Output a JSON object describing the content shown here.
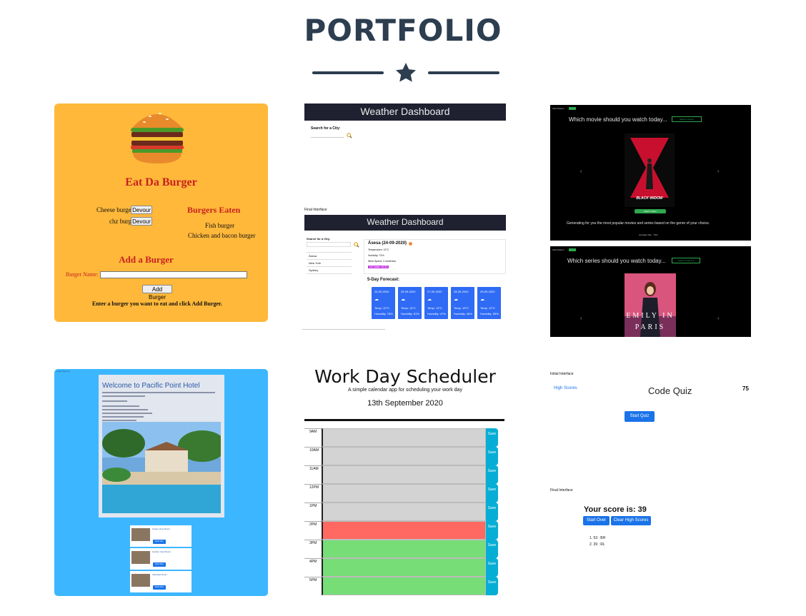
{
  "header": {
    "title": "PORTFOLIO"
  },
  "colors": {
    "heading": "#2c3e50",
    "burger_bg": "#ffb83a",
    "hotel_bg": "#3cb7ff"
  },
  "burger": {
    "title": "Eat Da Burger",
    "items": [
      {
        "name": "Cheese burger",
        "btn": "Devour"
      },
      {
        "name": "chz burg",
        "btn": "Devour"
      }
    ],
    "eaten_title": "Burgers Eaten",
    "eaten": [
      "Fish burger",
      "Chicken and bacon burger"
    ],
    "add_title": "Add a Burger",
    "name_label": "Burger Name:",
    "add_btn": "Add Burger",
    "hint": "Enter a burger you want to eat and click Add Burger."
  },
  "weather": {
    "title": "Weather Dashboard",
    "search_label": "Search for a City:",
    "final_label": "Final Interface",
    "city_title": "Ásesa (24-09-2020)",
    "stats": [
      "Temperature: 19°C",
      "Humidity: 74%",
      "Wind Speed: 3 metre/sec",
      "UV Index: 10.31"
    ],
    "cities": [
      "Ásesa",
      "New York",
      "Sydney"
    ],
    "forecast_title": "5-Day Forecast:",
    "forecast": [
      {
        "date": "25-09-2020",
        "temp": "Temp: 12°C",
        "hum": "Humidity: 78%"
      },
      {
        "date": "26-09-2020",
        "temp": "Temp: 14°C",
        "hum": "Humidity: 61%"
      },
      {
        "date": "27-09-2020",
        "temp": "Temp: 13°C",
        "hum": "Humidity: 47%"
      },
      {
        "date": "28-09-2020",
        "temp": "Temp: 15°C",
        "hum": "Humidity: 46%"
      },
      {
        "date": "29-09-2020",
        "temp": "Temp: 12°C",
        "hum": "Humidity: 55%"
      }
    ]
  },
  "movie": {
    "question1": "Which movie should you watch today...",
    "question2": "Which series should you watch today...",
    "select1": "Select a Genre",
    "select2": "Select a Genre ▾",
    "poster1_title": "BLACK WIDOW",
    "poster2_title": "EMILY IN PARIS",
    "info": "Generating for you the most popular movies and series based on the genre of your choice.",
    "watch_btn": "Watch Trailer",
    "rating": "Average Vote : 7/10"
  },
  "hotel": {
    "nav": "Login   Sign Up",
    "title": "Welcome to Pacific Point Hotel",
    "rooms": [
      "Ocean View Room",
      "Garden View Room",
      "Standard Room"
    ],
    "book_btn": "Book Now"
  },
  "scheduler": {
    "title": "Work Day Scheduler",
    "subtitle": "A simple calendar app for scheduling your work day",
    "date": "13th September 2020",
    "save": "Save",
    "hours": [
      {
        "label": "9AM",
        "state": "past"
      },
      {
        "label": "10AM",
        "state": "past"
      },
      {
        "label": "11AM",
        "state": "past"
      },
      {
        "label": "12PM",
        "state": "past"
      },
      {
        "label": "1PM",
        "state": "past"
      },
      {
        "label": "2PM",
        "state": "present"
      },
      {
        "label": "3PM",
        "state": "future"
      },
      {
        "label": "4PM",
        "state": "future"
      },
      {
        "label": "5PM",
        "state": "future"
      }
    ]
  },
  "quiz": {
    "initial_label": "Initial Interface",
    "high_scores": "High Scores",
    "title": "Code Quiz",
    "timer": "75",
    "start": "Start Quiz",
    "final_label": "Final Interface",
    "score": "Your score is: 39",
    "start_over": "Start Over",
    "clear": "Clear High Scores",
    "list": [
      "1. 53 : BH",
      "2. 39 : RL"
    ]
  }
}
